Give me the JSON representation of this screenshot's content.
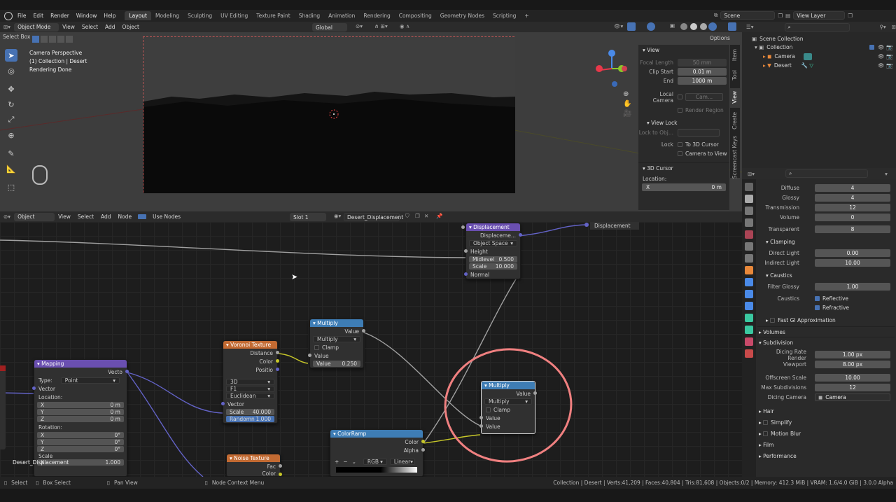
{
  "menu": [
    "File",
    "Edit",
    "Render",
    "Window",
    "Help"
  ],
  "workspaces": [
    "Layout",
    "Modeling",
    "Sculpting",
    "UV Editing",
    "Texture Paint",
    "Shading",
    "Animation",
    "Rendering",
    "Compositing",
    "Geometry Nodes",
    "Scripting"
  ],
  "active_workspace": "Layout",
  "scene": "Scene",
  "view_layer": "View Layer",
  "viewport_header": {
    "mode": "Object Mode",
    "items": [
      "View",
      "Select",
      "Add",
      "Object"
    ],
    "orientation": "Global",
    "options": "Options",
    "select_box": "Select Box"
  },
  "viewport_info": [
    "Camera Perspective",
    "(1) Collection | Desert",
    "Rendering Done"
  ],
  "npanel": {
    "tabs": [
      "Item",
      "Tool",
      "View",
      "Create",
      "Screencast Keys"
    ],
    "view_header": "View",
    "focal_length_label": "Focal Length",
    "focal_length": "50 mm",
    "clip_start_label": "Clip Start",
    "clip_start": "0.01 m",
    "end_label": "End",
    "end": "1000 m",
    "local_camera_label": "Local Camera",
    "local_camera_value": "Cam...",
    "render_region": "Render Region",
    "view_lock_header": "View Lock",
    "lock_to_obj": "Lock to Obj...",
    "lock_label": "Lock",
    "to_3d_cursor": "To 3D Cursor",
    "camera_to_view": "Camera to View",
    "cursor_header": "3D Cursor",
    "location_label": "Location:",
    "x_label": "X",
    "x_value": "0 m"
  },
  "outliner": {
    "scene_collection": "Scene Collection",
    "collection": "Collection",
    "items": [
      "Camera",
      "Desert"
    ]
  },
  "node_header": {
    "object": "Object",
    "items": [
      "View",
      "Select",
      "Add",
      "Node"
    ],
    "use_nodes": "Use Nodes",
    "slot": "Slot 1",
    "material": "Desert_Displacement"
  },
  "nodes": {
    "displacement": {
      "title": "Displacement",
      "out": "Displaceme...",
      "space": "Object Space",
      "height": "Height",
      "midlevel": "Midlevel",
      "midlevel_v": "0.500",
      "scale": "Scale",
      "scale_v": "10.000",
      "normal": "Normal"
    },
    "mo_out": "Displacement",
    "multiply1": {
      "title": "Multiply",
      "out": "Value",
      "op": "Multiply",
      "clamp": "Clamp",
      "in1": "Value",
      "in2": "Value",
      "in2_v": "0.250"
    },
    "voronoi": {
      "title": "Voronoi Texture",
      "distance": "Distance",
      "color": "Color",
      "position": "Positio",
      "dim": "3D",
      "feature": "F1",
      "metric": "Euclidean",
      "vector": "Vector",
      "scale": "Scale",
      "scale_v": "40.000",
      "random": "Randomn",
      "random_v": "1.000"
    },
    "mapping": {
      "title": "Mapping",
      "out": "Vecto",
      "type_label": "Type:",
      "type": "Point",
      "vector": "Vector",
      "location": "Location:",
      "x": "X",
      "y": "Y",
      "z": "Z",
      "loc_v": "0 m",
      "rotation": "Rotation:",
      "rot_v": "0°",
      "scale": "Scale",
      "scale_v": "1.000"
    },
    "multiply2": {
      "title": "Multiply",
      "out": "Value",
      "op": "Multiply",
      "clamp": "Clamp",
      "in1": "Value",
      "in2": "Value"
    },
    "colorramp": {
      "title": "ColorRamp",
      "color": "Color",
      "alpha": "Alpha",
      "mode": "RGB",
      "interp": "Linear"
    },
    "noise": {
      "title": "Noise Texture",
      "fac": "Fac",
      "color": "Color"
    },
    "material_label": "Desert_Displacement"
  },
  "properties": {
    "diffuse_label": "Diffuse",
    "diffuse": "4",
    "glossy_label": "Glossy",
    "glossy": "4",
    "transmission_label": "Transmission",
    "transmission": "12",
    "volume_label": "Volume",
    "volume": "0",
    "transparent_label": "Transparent",
    "transparent": "8",
    "clamping": "Clamping",
    "direct_label": "Direct Light",
    "direct": "0.00",
    "indirect_label": "Indirect Light",
    "indirect": "10.00",
    "caustics": "Caustics",
    "filter_glossy_label": "Filter Glossy",
    "filter_glossy": "1.00",
    "caustics_label": "Caustics",
    "reflective": "Reflective",
    "refractive": "Refractive",
    "fast_gi": "Fast GI Approximation",
    "volumes": "Volumes",
    "subdivision": "Subdivision",
    "dicing_rate_label": "Dicing Rate Render",
    "dicing_rate": "1.00 px",
    "viewport_label": "Viewport",
    "viewport": "8.00 px",
    "offscreen_label": "Offscreen Scale",
    "offscreen": "10.00",
    "max_subdiv_label": "Max Subdivisions",
    "max_subdiv": "12",
    "dicing_camera_label": "Dicing Camera",
    "dicing_camera": "Camera",
    "hair": "Hair",
    "simplify": "Simplify",
    "motion_blur": "Motion Blur",
    "film": "Film",
    "performance": "Performance"
  },
  "status": {
    "select": "Select",
    "box_select": "Box Select",
    "pan_view": "Pan View",
    "context_menu": "Node Context Menu",
    "stats": "Collection | Desert | Verts:41,209 | Faces:40,804 | Tris:81,608 | Objects:0/2 | Memory: 412.3 MiB | VRAM: 1.6/4.0 GiB | 3.0.0 Alpha"
  },
  "colors": {
    "accent": "#4772b3",
    "annotation": "#f08080",
    "converter": "#3e7db5",
    "vector": "#6a4fb0",
    "texture": "#c26a32"
  }
}
